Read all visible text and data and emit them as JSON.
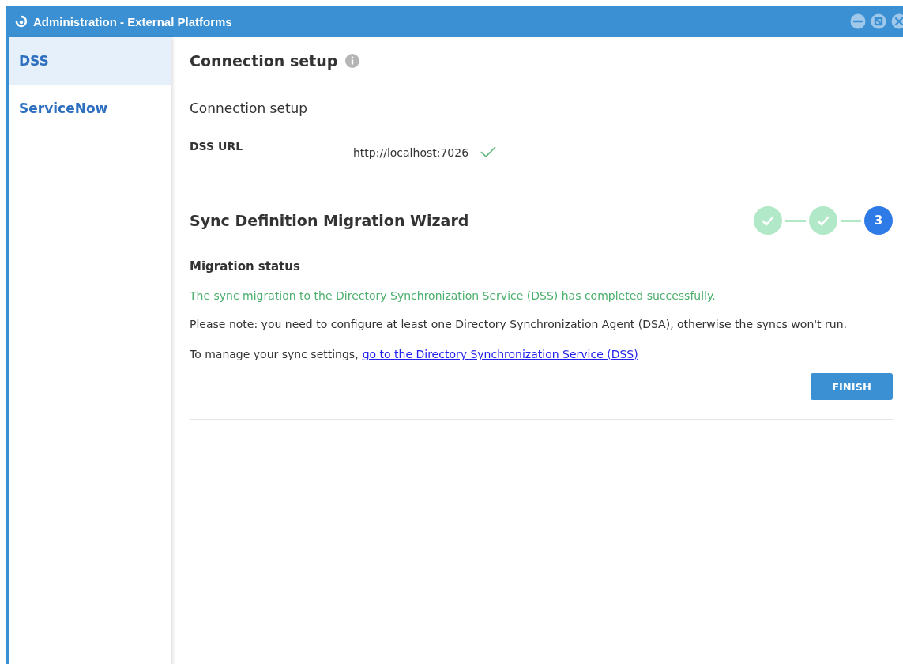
{
  "window": {
    "title": "Administration - External Platforms"
  },
  "sidebar": {
    "items": [
      {
        "label": "DSS",
        "selected": true
      },
      {
        "label": "ServiceNow",
        "selected": false
      }
    ]
  },
  "connection": {
    "heading": "Connection setup",
    "subheading": "Connection setup",
    "url_label": "DSS URL",
    "url_value": "http://localhost:7026",
    "url_valid": true
  },
  "wizard": {
    "heading": "Sync Definition Migration Wizard",
    "steps": [
      {
        "done": true
      },
      {
        "done": true
      },
      {
        "done": false,
        "label": "3"
      }
    ],
    "status_heading": "Migration status",
    "success_message": "The sync migration to the Directory Synchronization Service (DSS) has completed successfully.",
    "note": "Please note: you need to configure at least one Directory Synchronization Agent (DSA), otherwise the syncs won't run.",
    "manage_text": "To manage your sync settings,",
    "manage_link": "go to the Directory Synchronization Service (DSS)",
    "finish_button": "FINISH"
  }
}
